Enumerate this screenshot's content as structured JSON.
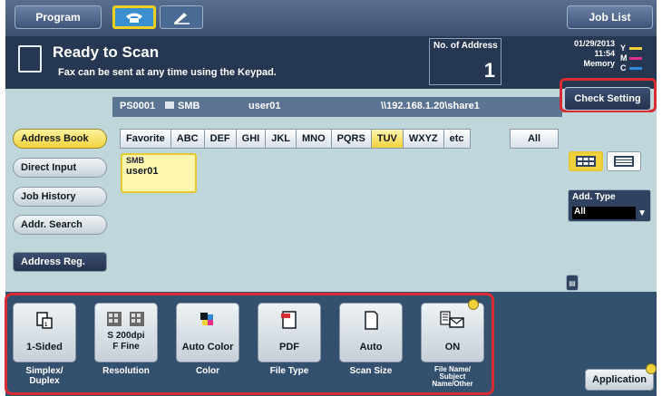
{
  "topbar": {
    "program_label": "Program",
    "joblist_label": "Job List",
    "mode_fax_icon": "phone-icon",
    "mode_scan_icon": "pen-icon"
  },
  "status": {
    "title": "Ready to Scan",
    "subtitle": "Fax can be sent at any time using the Keypad.",
    "address_label": "No. of Address",
    "address_count": "1",
    "date": "01/29/2013",
    "time": "11:54",
    "memory_label": "Memory",
    "toner": [
      {
        "letter": "Y",
        "color": "#f2d23c"
      },
      {
        "letter": "M",
        "color": "#e0308a"
      },
      {
        "letter": "C",
        "color": "#2e8ad8"
      }
    ]
  },
  "destination": {
    "id": "PS0001",
    "protocol": "SMB",
    "user": "user01",
    "path": "\\\\192.168.1.20\\share1"
  },
  "check_setting_label": "Check Setting",
  "sidebar": {
    "items": [
      {
        "label": "Address Book",
        "active": true
      },
      {
        "label": "Direct Input"
      },
      {
        "label": "Job History"
      },
      {
        "label": "Addr. Search"
      }
    ],
    "address_reg_label": "Address Reg."
  },
  "tabs": [
    "Favorite",
    "ABC",
    "DEF",
    "GHI",
    "JKL",
    "MNO",
    "PQRS",
    "TUV",
    "WXYZ",
    "etc"
  ],
  "tab_active_index": 7,
  "tab_all_label": "All",
  "entry": {
    "protocol": "SMB",
    "name": "user01"
  },
  "add_type": {
    "label": "Add. Type",
    "value": "All"
  },
  "settings": [
    {
      "value": "1-Sided",
      "label": "Simplex/\nDuplex",
      "icon": "simplex-icon"
    },
    {
      "value": "S 200dpi\nF Fine",
      "label": "Resolution",
      "icon": "resolution-icon"
    },
    {
      "value": "Auto Color",
      "label": "Color",
      "icon": "color-icon"
    },
    {
      "value": "PDF",
      "label": "File Type",
      "icon": "pdf-icon"
    },
    {
      "value": "Auto",
      "label": "Scan Size",
      "icon": "document-icon"
    },
    {
      "value": "ON",
      "label": "File Name/\nSubject\nName/Other",
      "icon": "email-icon"
    }
  ],
  "application_label": "Application",
  "colors": {
    "highlight": "#d92c32",
    "active_yellow": "#f2d23c",
    "panel_bg": "#bfd7da",
    "status_bg": "#263851"
  }
}
